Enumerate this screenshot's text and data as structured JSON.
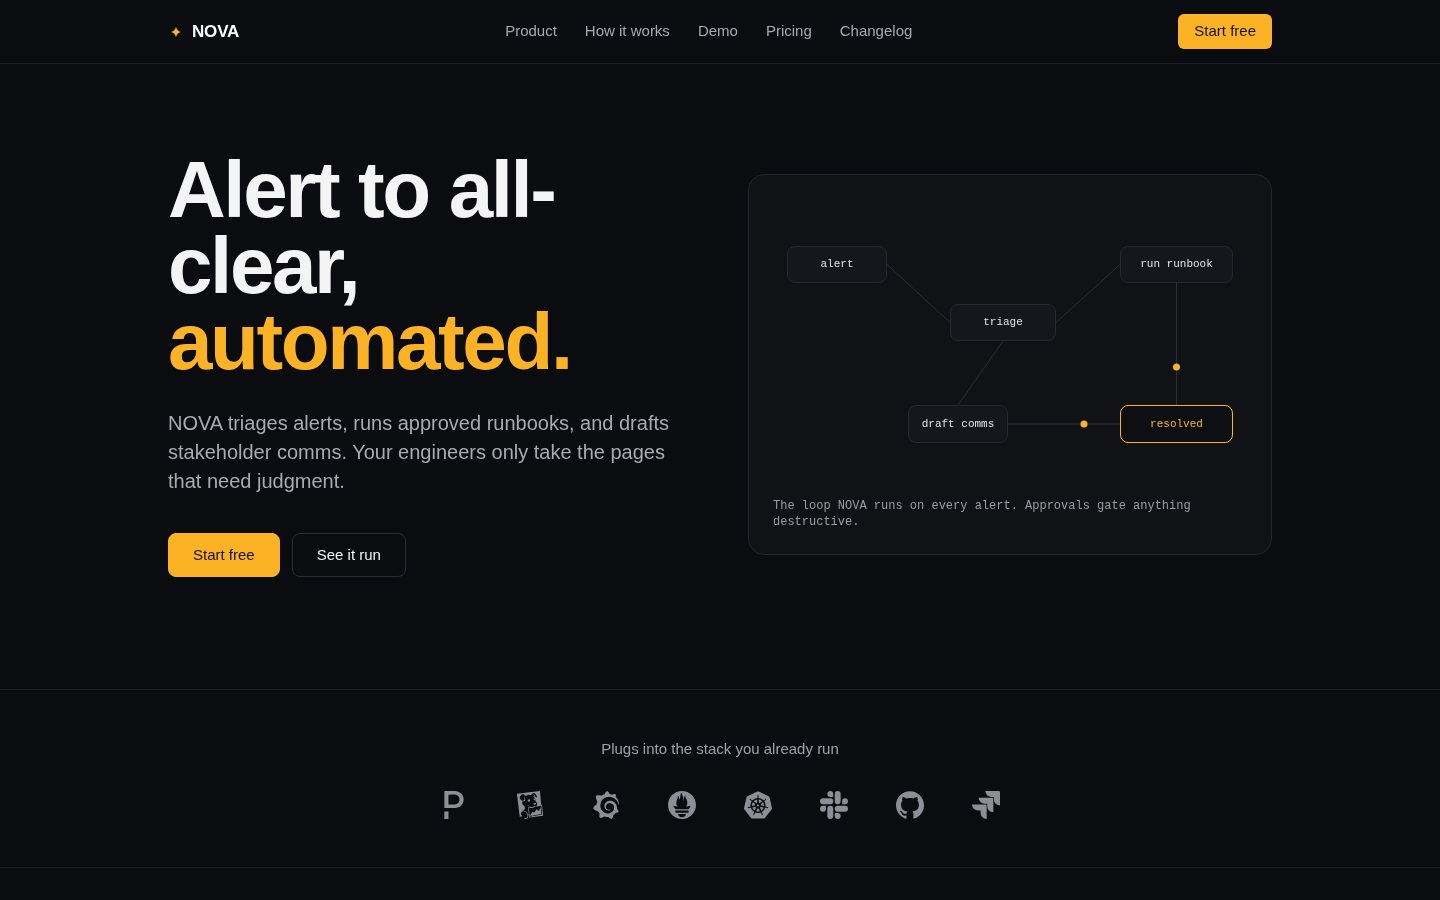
{
  "nav": {
    "logo": "NOVA",
    "links": [
      "Product",
      "How it works",
      "Demo",
      "Pricing",
      "Changelog"
    ],
    "cta": "Start free"
  },
  "hero": {
    "heading": "Alert to all-clear,",
    "heading_highlight": "automated.",
    "description": "NOVA triages alerts, runs approved runbooks, and drafts stakeholder comms. Your engineers only take the pages that need judgment.",
    "buttons": [
      {
        "label": "Start free",
        "kind": "primary"
      },
      {
        "label": "See it run",
        "kind": "secondary"
      }
    ]
  },
  "diagram": {
    "nodes": [
      {
        "label": "alert",
        "highlighted": false
      },
      {
        "label": "run runbook",
        "highlighted": false
      },
      {
        "label": "triage",
        "highlighted": false
      },
      {
        "label": "draft comms",
        "highlighted": false
      },
      {
        "label": "resolved",
        "highlighted": true
      }
    ],
    "edges": [
      {
        "dot": false
      },
      {
        "dot": false
      },
      {
        "dot": true
      },
      {
        "dot": false
      },
      {
        "dot": true
      }
    ],
    "caption": "The loop NOVA runs on every alert. Approvals gate anything destructive."
  },
  "integrations": {
    "title": "Plugs into the stack you already run"
  }
}
